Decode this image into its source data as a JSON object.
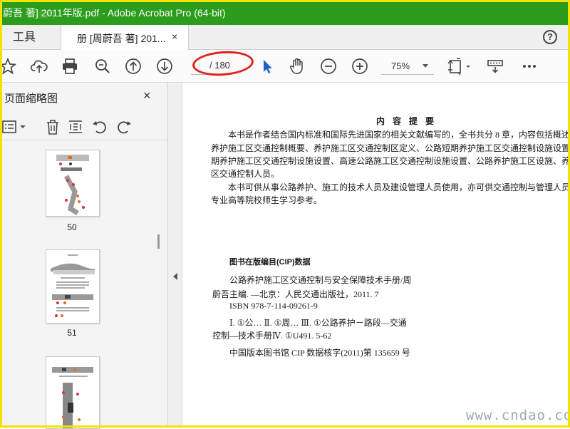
{
  "window": {
    "title": "蔚吾 著] 2011年版.pdf - Adobe Acrobat Pro (64-bit)",
    "faint_mark": "逐浪网"
  },
  "tabs": {
    "tools": "工具",
    "document": "册 [周蔚吾 著] 201...",
    "close": "×",
    "help": "?"
  },
  "toolbar": {
    "current_page": "",
    "page_total": "/ 180",
    "zoom": "75%"
  },
  "panel": {
    "title": "页面缩略图",
    "close": "×",
    "thumbnails": [
      "50",
      "51"
    ]
  },
  "document": {
    "heading": "内 容 提 要",
    "paragraph1": [
      "本书是作者结合国内标准和国际先进国家的相关文献编写的，全书共分 8 章，内容包括概述",
      "养护施工区交通控制概要、养护施工区交通控制区定义、公路短期养护施工区交通控制设施设置、公",
      "期养护施工区交通控制设施设置、高速公路施工区交通控制设施设置、公路养护施工区设施、养护",
      "区交通控制人员。"
    ],
    "paragraph2": [
      "本书可供从事公路养护、施工的技术人员及建设管理人员使用，亦可供交通控制与管理人员及",
      "专业高等院校师生学习参考。"
    ],
    "cip_title": "图书在版编目(CIP)数据",
    "cip_lines": [
      "公路养护施工区交通控制与安全保障技术手册/周",
      "蔚吾主编. —北京：人民交通出版社，2011. 7",
      "ISBN  978-7-114-09261-9",
      "Ⅰ. ①公…  Ⅱ. ①周…  Ⅲ. ①公路养护－路段—交通",
      "控制—技术手册Ⅳ. ①U491. 5-62",
      "中国版本图书馆 CIP 数据核字(2011)第 135659 号"
    ]
  },
  "watermark": "www.cndao.com",
  "colors": {
    "titlebar": "#2b9c1b",
    "frame": "#f2e400",
    "annotation": "#e0221b",
    "cursor": "#1f63c6"
  }
}
